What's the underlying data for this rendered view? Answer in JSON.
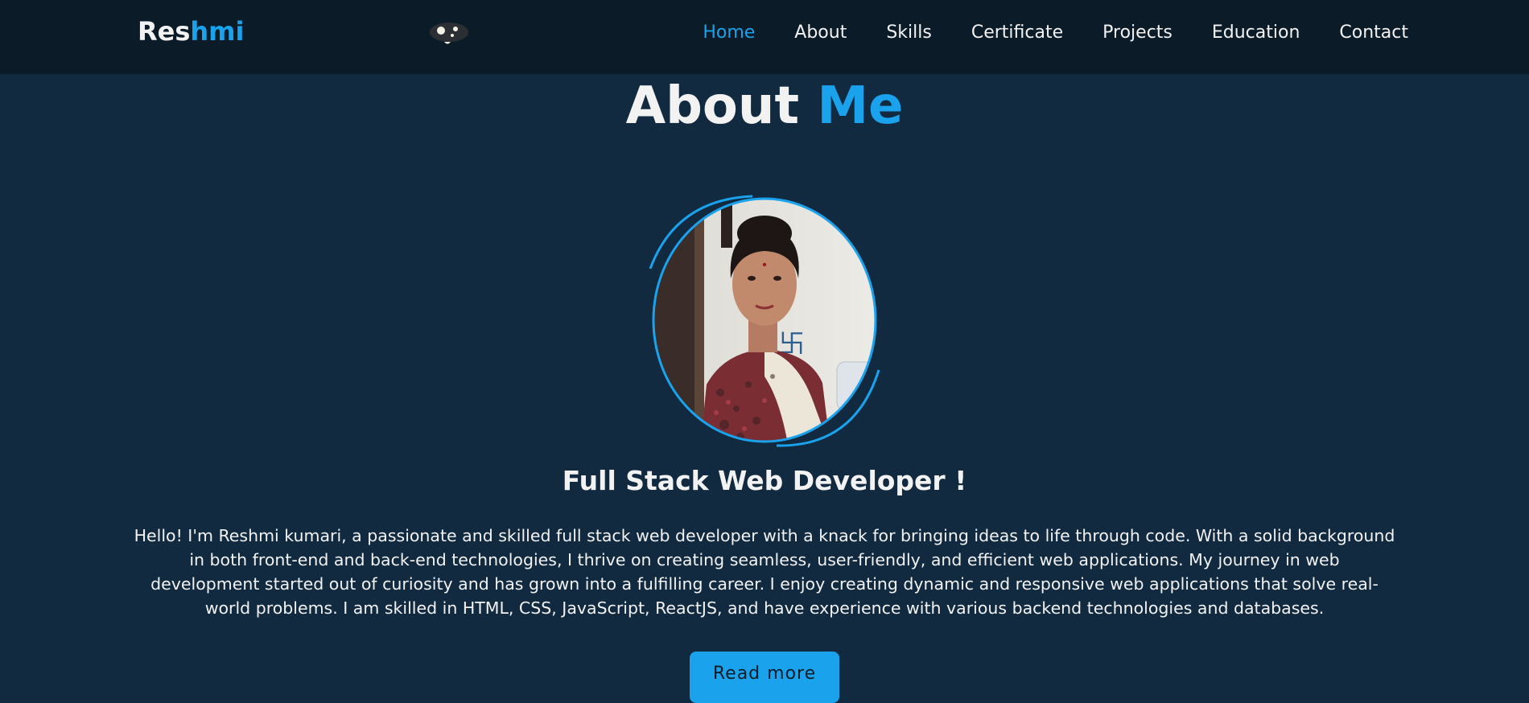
{
  "header": {
    "logo_primary": "Res",
    "logo_accent": "hmi",
    "mascot_icon": "robot-mascot-icon",
    "nav": [
      {
        "label": "Home",
        "active": true
      },
      {
        "label": "About",
        "active": false
      },
      {
        "label": "Skills",
        "active": false
      },
      {
        "label": "Certificate",
        "active": false
      },
      {
        "label": "Projects",
        "active": false
      },
      {
        "label": "Education",
        "active": false
      },
      {
        "label": "Contact",
        "active": false
      }
    ]
  },
  "about": {
    "title_primary": "About",
    "title_accent": "Me",
    "profile_photo": "profile-photo",
    "subtitle": "Full Stack Web Developer !",
    "bio": "Hello! I'm Reshmi kumari, a passionate and skilled full stack web developer with a knack for bringing ideas to life through code. With a solid background in both front-end and back-end technologies, I thrive on creating seamless, user-friendly, and efficient web applications. My journey in web development started out of curiosity and has grown into a fulfilling career. I enjoy creating dynamic and responsive web applications that solve real-world problems. I am skilled in HTML, CSS, JavaScript, ReactJS, and have experience with various backend technologies and databases.",
    "read_more_label": "Read more"
  },
  "colors": {
    "background": "#112a40",
    "navbar": "#0b1b28",
    "accent": "#1aa3ec",
    "text": "#f2f2f2"
  }
}
